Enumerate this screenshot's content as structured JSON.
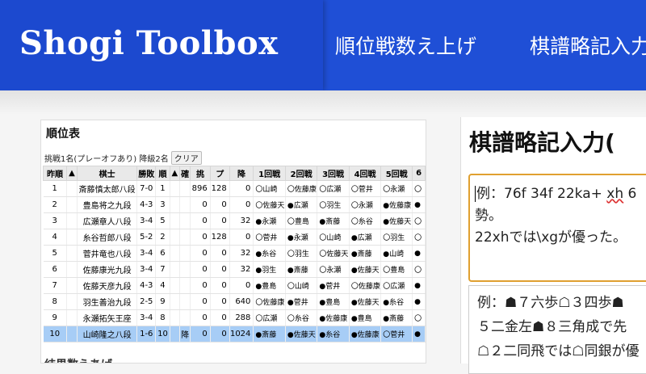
{
  "header": {
    "brand": "Shogi Toolbox",
    "nav": [
      "順位戦数え上げ",
      "棋譜略記入力"
    ]
  },
  "ranking": {
    "title": "順位表",
    "summary": "挑戦1名(プレーオフあり) 降級2名",
    "clear_label": "クリア",
    "columns": [
      "昨順",
      "▲",
      "棋士",
      "勝敗",
      "順",
      "▲",
      "確",
      "挑",
      "プ",
      "降",
      "1回戦",
      "2回戦",
      "3回戦",
      "4回戦",
      "5回戦",
      "6"
    ],
    "rows": [
      {
        "prev": "1",
        "name": "斎藤慎太郎八段",
        "record": "7-0",
        "rank": "1",
        "kaku": "",
        "cho": "896",
        "pu": "128",
        "ko": "0",
        "r1": "〇山崎",
        "r2": "〇佐藤康",
        "r3": "〇広瀬",
        "r4": "〇菅井",
        "r5": "〇永瀬",
        "r6": "〇"
      },
      {
        "prev": "2",
        "name": "豊島将之九段",
        "record": "4-3",
        "rank": "3",
        "kaku": "",
        "cho": "0",
        "pu": "0",
        "ko": "0",
        "r1": "〇佐藤天",
        "r2": "●広瀬",
        "r3": "〇羽生",
        "r4": "〇永瀬",
        "r5": "●佐藤康",
        "r6": "●"
      },
      {
        "prev": "3",
        "name": "広瀬章人八段",
        "record": "3-4",
        "rank": "5",
        "kaku": "",
        "cho": "0",
        "pu": "0",
        "ko": "32",
        "r1": "●永瀬",
        "r2": "〇豊島",
        "r3": "●斎藤",
        "r4": "〇糸谷",
        "r5": "●佐藤天",
        "r6": "〇"
      },
      {
        "prev": "4",
        "name": "糸谷哲郎八段",
        "record": "5-2",
        "rank": "2",
        "kaku": "",
        "cho": "0",
        "pu": "128",
        "ko": "0",
        "r1": "〇菅井",
        "r2": "●永瀬",
        "r3": "〇山崎",
        "r4": "●広瀬",
        "r5": "〇羽生",
        "r6": "〇"
      },
      {
        "prev": "5",
        "name": "菅井竜也八段",
        "record": "3-4",
        "rank": "6",
        "kaku": "",
        "cho": "0",
        "pu": "0",
        "ko": "32",
        "r1": "●糸谷",
        "r2": "〇羽生",
        "r3": "〇佐藤天",
        "r4": "●斎藤",
        "r5": "●山崎",
        "r6": "●"
      },
      {
        "prev": "6",
        "name": "佐藤康光九段",
        "record": "3-4",
        "rank": "7",
        "kaku": "",
        "cho": "0",
        "pu": "0",
        "ko": "32",
        "r1": "●羽生",
        "r2": "●斎藤",
        "r3": "〇永瀬",
        "r4": "●佐藤天",
        "r5": "〇豊島",
        "r6": "〇"
      },
      {
        "prev": "7",
        "name": "佐藤天彦九段",
        "record": "4-3",
        "rank": "4",
        "kaku": "",
        "cho": "0",
        "pu": "0",
        "ko": "0",
        "r1": "●豊島",
        "r2": "〇山崎",
        "r3": "●菅井",
        "r4": "〇佐藤康",
        "r5": "〇広瀬",
        "r6": "●"
      },
      {
        "prev": "8",
        "name": "羽生善治九段",
        "record": "2-5",
        "rank": "9",
        "kaku": "",
        "cho": "0",
        "pu": "0",
        "ko": "640",
        "r1": "〇佐藤康",
        "r2": "●菅井",
        "r3": "●豊島",
        "r4": "●佐藤天",
        "r5": "●糸谷",
        "r6": "●"
      },
      {
        "prev": "9",
        "name": "永瀬拓矢王座",
        "record": "3-4",
        "rank": "8",
        "kaku": "",
        "cho": "0",
        "pu": "0",
        "ko": "288",
        "r1": "〇広瀬",
        "r2": "〇糸谷",
        "r3": "●佐藤康",
        "r4": "●豊島",
        "r5": "●斎藤",
        "r6": "〇"
      },
      {
        "prev": "10",
        "name": "山崎隆之八段",
        "record": "1-6",
        "rank": "10",
        "kaku": "降",
        "cho": "0",
        "pu": "0",
        "ko": "1024",
        "r1": "●斎藤",
        "r2": "●佐藤天",
        "r3": "●糸谷",
        "r4": "●佐藤康",
        "r5": "〇菅井",
        "r6": "●"
      }
    ],
    "next_heading": "结果数えあげ"
  },
  "kifu": {
    "title": "棋譜略記入力(",
    "input_lines": [
      "例：76f 34f 22ka+ ",
      "xh",
      " 6",
      "勢。",
      "22xhでは\\xgが優った。"
    ],
    "output_lines": [
      "例：☗７六歩☖３四歩☗",
      "５二金左☗８三角成で先",
      "☖２二同飛では☖同銀が優"
    ]
  }
}
